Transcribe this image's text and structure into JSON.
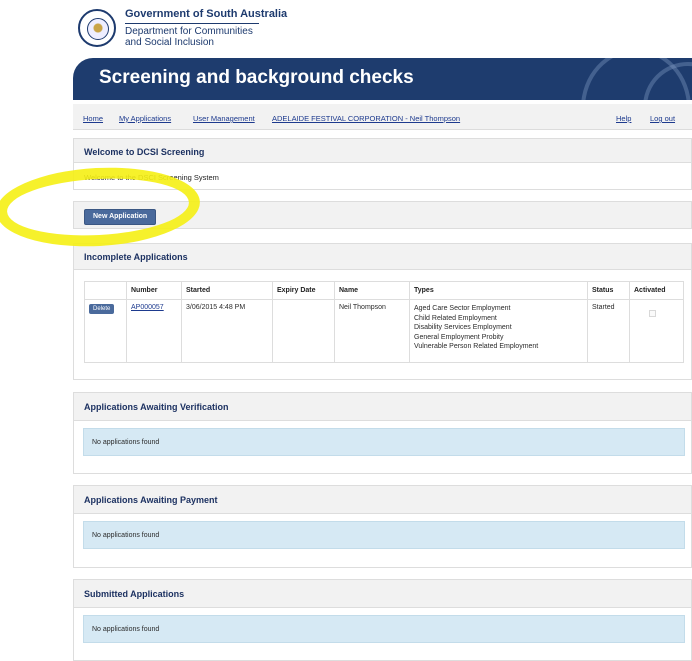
{
  "header": {
    "gov_name": "Government of South Australia",
    "dept_line1": "Department for Communities",
    "dept_line2": "and Social Inclusion",
    "banner_title": "Screening and background checks"
  },
  "nav": {
    "home": "Home",
    "my_applications": "My Applications",
    "user_management": "User Management",
    "organisation": "ADELAIDE FESTIVAL CORPORATION - Neil Thompson",
    "help": "Help",
    "logout": "Log out"
  },
  "welcome": {
    "title": "Welcome to DCSI Screening",
    "message": "Welcome to the DSCI Screening System"
  },
  "actions": {
    "new_application": "New Application"
  },
  "incomplete": {
    "title": "Incomplete Applications",
    "columns": [
      "Number",
      "Started",
      "Expiry Date",
      "Name",
      "Types",
      "Status",
      "Activated"
    ],
    "rows": [
      {
        "delete": "Delete",
        "number": "AP000057",
        "started": "3/06/2015 4:48 PM",
        "expiry": "",
        "name": "Neil Thompson",
        "types": [
          "Aged Care Sector Employment",
          "Child Related Employment",
          "Disability Services Employment",
          "General Employment Probity",
          "Vulnerable Person Related Employment"
        ],
        "status": "Started",
        "activated": false
      }
    ]
  },
  "awaiting_verification": {
    "title": "Applications Awaiting Verification",
    "empty": "No applications found"
  },
  "awaiting_payment": {
    "title": "Applications Awaiting Payment",
    "empty": "No applications found"
  },
  "submitted": {
    "title": "Submitted Applications",
    "empty": "No applications found"
  },
  "colors": {
    "brand_navy": "#1e3c6e",
    "button": "#4a6a9c",
    "info_box": "#d6e9f4",
    "annotation_highlight": "#f5f014"
  }
}
